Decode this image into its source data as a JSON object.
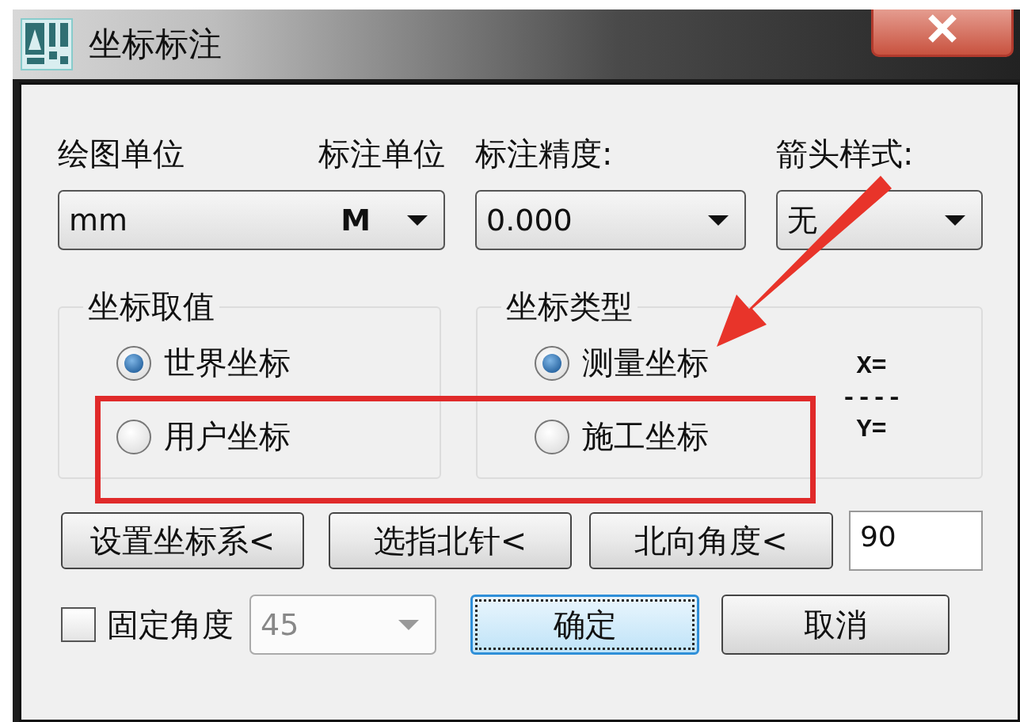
{
  "window": {
    "title": "坐标标注"
  },
  "labels": {
    "drawing_unit": "绘图单位",
    "dimension_unit": "标注单位",
    "precision": "标注精度:",
    "arrow_style": "箭头样式:"
  },
  "unit_combo": {
    "value": "mm",
    "unit": "M"
  },
  "precision_combo": {
    "value": "0.000"
  },
  "arrow_combo": {
    "value": "无"
  },
  "groups": [
    {
      "title": "坐标取值",
      "options": [
        {
          "label": "世界坐标",
          "selected": true
        },
        {
          "label": "用户坐标",
          "selected": false
        }
      ]
    },
    {
      "title": "坐标类型",
      "options": [
        {
          "label": "测量坐标",
          "selected": true
        },
        {
          "label": "施工坐标",
          "selected": false
        }
      ],
      "legend": {
        "x": "X=",
        "divider": "----",
        "y": "Y="
      }
    }
  ],
  "pick_buttons": [
    "设置坐标系<",
    "选指北针<",
    "北向角度<"
  ],
  "angle_field": {
    "value": "90"
  },
  "fixed_angle": {
    "label": "固定角度",
    "checked": false,
    "value": "45",
    "disabled": true
  },
  "ok_button": {
    "label": "确定",
    "focused": true
  },
  "cancel_button": {
    "label": "取消"
  },
  "annotations": {
    "highlight_box": true,
    "arrow": true
  }
}
